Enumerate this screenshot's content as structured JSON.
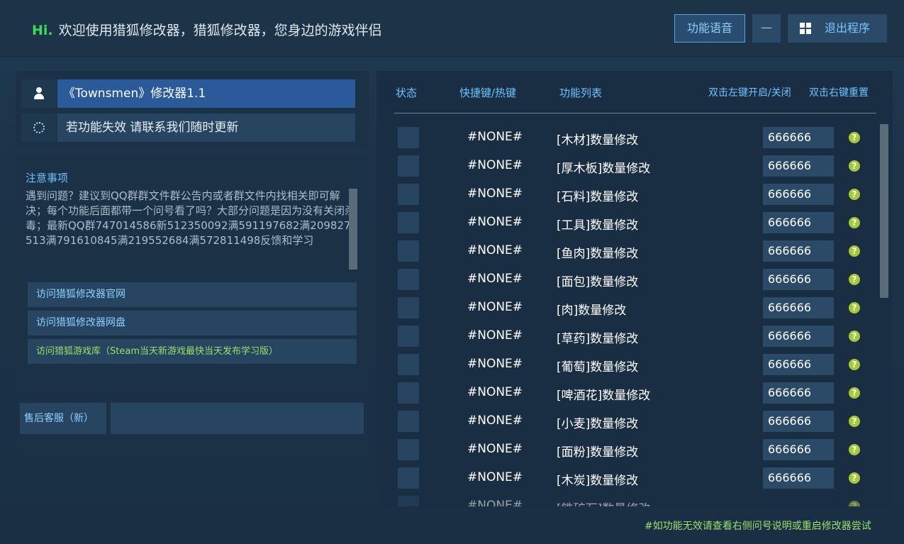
{
  "header": {
    "hi": "Hi.",
    "welcome": "欢迎使用猎狐修改器，猎狐修改器，您身边的游戏伴侣",
    "voice_button": "功能语音",
    "minimize_button": "—",
    "exit_button": "退出程序"
  },
  "left": {
    "trainer_title": "《Townsmen》修改器1.1",
    "tip": "若功能失效 请联系我们随时更新",
    "notice_title": "注意事项",
    "notice_text": "遇到问题？建议到QQ群群文件群公告内或者群文件内找相关即可解决；每个功能后面都带一个问号看了吗？大部分问题是因为没有关闭杀毒；最新QQ群747014586新512350092满591197682满209827513满791610845满219552684满572811498反馈和学习",
    "links": [
      "访问猎狐修改器官网",
      "访问猎狐修改器网盘",
      "访问猎狐游戏库（Steam当天新游戏最快当天发布学习版）"
    ],
    "service_label": "售后客服（新）"
  },
  "table": {
    "col_status": "状态",
    "col_hotkey": "快捷键/热键",
    "col_function": "功能列表",
    "hint_left": "双击左键开启/关闭",
    "hint_right": "双击右键重置",
    "rows": [
      {
        "hotkey": "#NONE#",
        "name": "[木材]数量修改",
        "value": "666666"
      },
      {
        "hotkey": "#NONE#",
        "name": "[厚木板]数量修改",
        "value": "666666"
      },
      {
        "hotkey": "#NONE#",
        "name": "[石料]数量修改",
        "value": "666666"
      },
      {
        "hotkey": "#NONE#",
        "name": "[工具]数量修改",
        "value": "666666"
      },
      {
        "hotkey": "#NONE#",
        "name": "[鱼肉]数量修改",
        "value": "666666"
      },
      {
        "hotkey": "#NONE#",
        "name": "[面包]数量修改",
        "value": "666666"
      },
      {
        "hotkey": "#NONE#",
        "name": "[肉]数量修改",
        "value": "666666"
      },
      {
        "hotkey": "#NONE#",
        "name": "[草药]数量修改",
        "value": "666666"
      },
      {
        "hotkey": "#NONE#",
        "name": "[葡萄]数量修改",
        "value": "666666"
      },
      {
        "hotkey": "#NONE#",
        "name": "[啤酒花]数量修改",
        "value": "666666"
      },
      {
        "hotkey": "#NONE#",
        "name": "[小麦]数量修改",
        "value": "666666"
      },
      {
        "hotkey": "#NONE#",
        "name": "[面粉]数量修改",
        "value": "666666"
      },
      {
        "hotkey": "#NONE#",
        "name": "[木炭]数量修改",
        "value": "666666"
      }
    ],
    "partial_row": {
      "hotkey": "#NONE#",
      "name": "[铁矿石]数量修改"
    },
    "help_glyph": "?"
  },
  "footer": "#如功能无效请查看右侧问号说明或重启修改器尝试"
}
